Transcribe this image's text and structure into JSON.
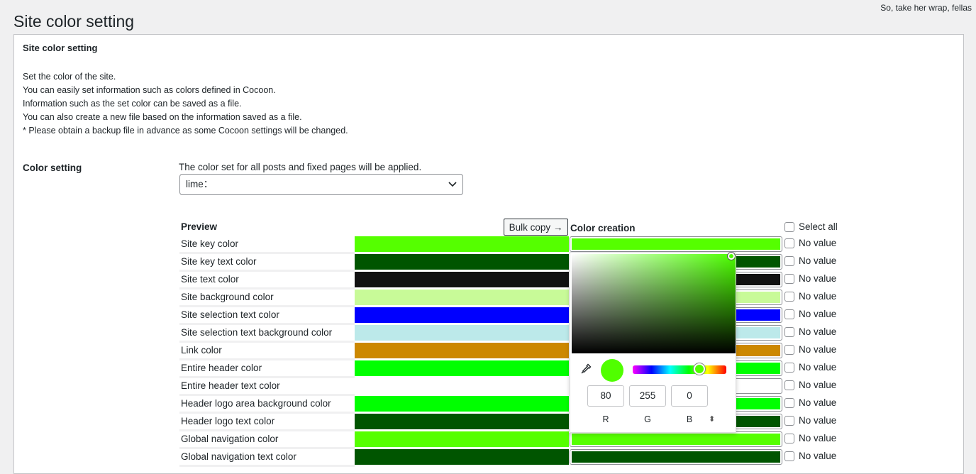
{
  "user_greeting": "So, take her wrap, fellas",
  "page_title": "Site color setting",
  "panel": {
    "title": "Site color setting",
    "description": [
      "Set the color of the site.",
      "You can easily set information such as colors defined in Cocoon.",
      "Information such as the set color can be saved as a file.",
      "You can also create a new file based on the information saved as a file.",
      "* Please obtain a backup file in advance as some Cocoon settings will be changed."
    ]
  },
  "color_setting": {
    "label": "Color setting",
    "note": "The color set for all posts and fixed pages will be applied.",
    "selected": "lime："
  },
  "table": {
    "preview_header": "Preview",
    "bulk_copy_label": "Bulk copy →",
    "color_creation_header": "Color creation",
    "select_all_label": "Select all",
    "no_value_label": "No value",
    "rows": [
      {
        "name": "Site key color",
        "color": "#55ff00"
      },
      {
        "name": "Site key text color",
        "color": "#005500"
      },
      {
        "name": "Site text color",
        "color": "#111111"
      },
      {
        "name": "Site background color",
        "color": "#c8fa98"
      },
      {
        "name": "Site selection text color",
        "color": "#0000ff"
      },
      {
        "name": "Site selection text background color",
        "color": "#bce9ea"
      },
      {
        "name": "Link color",
        "color": "#cc8800"
      },
      {
        "name": "Entire header color",
        "color": "#00ff00"
      },
      {
        "name": "Entire header text color",
        "color": "#ffffff"
      },
      {
        "name": "Header logo area background color",
        "color": "#00ff00"
      },
      {
        "name": "Header logo text color",
        "color": "#005500"
      },
      {
        "name": "Global navigation color",
        "color": "#55ff00"
      },
      {
        "name": "Global navigation text color",
        "color": "#005500"
      }
    ]
  },
  "picker": {
    "current_color": "#50ff00",
    "r": "80",
    "g": "255",
    "b": "0",
    "r_label": "R",
    "g_label": "G",
    "b_label": "B",
    "mode_toggle": "⬍"
  }
}
